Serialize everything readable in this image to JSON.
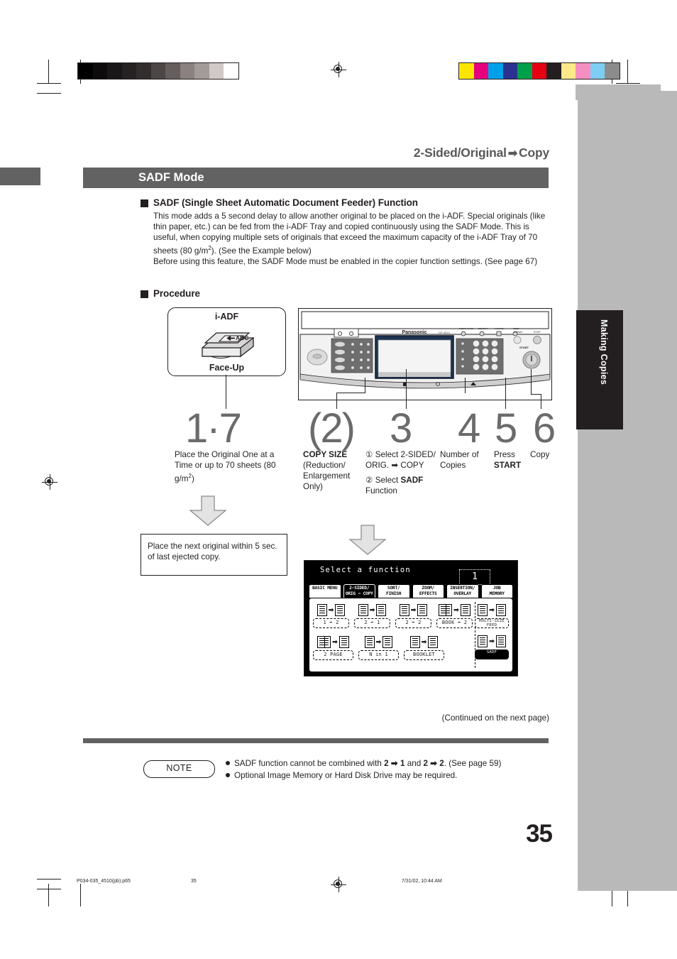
{
  "document": {
    "running_head": "2-Sided/Original",
    "running_head_arrow": "➡",
    "running_head_tail": "Copy",
    "section_title": "SADF Mode",
    "page_number": "35",
    "continued": "(Continued on the next page)",
    "side_tab_label": "Making Copies"
  },
  "function_section": {
    "heading": "SADF (Single Sheet Automatic Document Feeder) Function",
    "paragraph_1": "This mode adds a 5 second delay to allow another original to be placed on the i-ADF. Special originals (like thin paper, etc.) can be fed from the i-ADF Tray and copied continuously using the SADF Mode. This is useful, when copying multiple sets of originals that exceed the maximum capacity of the i-ADF Tray of 70 sheets (80 g/m",
    "paragraph_1_sup": "2",
    "paragraph_1_tail": "). (See the Example below)",
    "paragraph_2": "Before using this feature, the SADF Mode must be enabled in the copier function settings. (See page 67)"
  },
  "procedure": {
    "heading": "Procedure",
    "iadf_label": "i-ADF",
    "faceup_label": "Face-Up",
    "adf_original_text": "ABC",
    "next_original_note": "Place the next original within 5 sec. of last ejected copy.",
    "steps": [
      {
        "number": "1·7",
        "caption": "Place the Original One at a Time or up to 70 sheets (80 g/m",
        "caption_sup": "2",
        "caption_tail": ")"
      },
      {
        "number": "(2)",
        "caption_bold": "COPY SIZE",
        "caption": "(Reduction/ Enlargement Only)"
      },
      {
        "number": "3",
        "sub_1_marker": "①",
        "sub_1_text": "Select 2-SIDED/ ORIG. ➡ COPY",
        "sub_2_marker": "②",
        "sub_2_prefix": "Select ",
        "sub_2_bold": "SADF",
        "sub_2_suffix": " Function"
      },
      {
        "number": "4",
        "caption": "Number of Copies"
      },
      {
        "number": "5",
        "caption_prefix": "Press",
        "caption_bold": "START"
      },
      {
        "number": "6",
        "caption": "Copy"
      }
    ]
  },
  "lcd": {
    "title": "Select a function",
    "copy_count": "1",
    "tabs": [
      {
        "label_1": "BASIC MENU",
        "label_2": "",
        "selected": false
      },
      {
        "label_1": "2-SIDED/",
        "label_2": "ORIG ➡ COPY",
        "selected": true
      },
      {
        "label_1": "SORT/",
        "label_2": "FINISH",
        "selected": false
      },
      {
        "label_1": "ZOOM/",
        "label_2": "EFFECTS",
        "selected": false
      },
      {
        "label_1": "INSERTION/",
        "label_2": "OVERLAY",
        "selected": false
      },
      {
        "label_1": "JOB",
        "label_2": "MEMORY",
        "selected": false
      }
    ],
    "buttons_row_1": [
      {
        "label": "1 ➡ 2"
      },
      {
        "label": "2 ➡ 1"
      },
      {
        "label": "2 ➡ 2"
      },
      {
        "label": "BOOK ➡ 2"
      }
    ],
    "buttons_row_2": [
      {
        "label": "2 PAGE"
      },
      {
        "label": "N in 1"
      },
      {
        "label": "BOOKLET"
      }
    ],
    "buttons_right": [
      {
        "label": "MULTI-SIZE FEED",
        "selected": false
      },
      {
        "label": "SADF",
        "selected": true
      }
    ]
  },
  "panel": {
    "brand": "Panasonic",
    "model": "DP-4510",
    "start_label": "START",
    "clear_label": "CLEAR",
    "stop_label": "STOP"
  },
  "note": {
    "label": "NOTE",
    "item_1_a": "SADF function cannot be combined with ",
    "item_1_b": "2",
    "item_1_c": " ➡ ",
    "item_1_d": "1",
    "item_1_e": " and ",
    "item_1_f": "2",
    "item_1_g": " ➡ ",
    "item_1_h": "2",
    "item_1_i": ". (See page 59)",
    "item_2": "Optional Image Memory or Hard Disk Drive may be required."
  },
  "footer": {
    "filename": "P034-035_4510(pb).p65",
    "page": "35",
    "timestamp": "7/31/02, 10:44 AM"
  },
  "colors": {
    "title_gray": "#626262",
    "side_gray": "#b9b9b9",
    "tab_black": "#231f20",
    "step_gray": "#6b6b6b"
  },
  "calibration": {
    "gray_swatches": [
      "#000000",
      "#0d0b0c",
      "#1a1718",
      "#262223",
      "#332e2e",
      "#4d4646",
      "#665e5d",
      "#8a8180",
      "#a39b99",
      "#d0c9c7",
      "#ffffff"
    ],
    "color_swatches": [
      "#ffe600",
      "#e6007e",
      "#00a0e9",
      "#2b3190",
      "#00a04a",
      "#e60012",
      "#231f20",
      "#fbe98a",
      "#f happy",
      "#7ecef4",
      "#8c8c8c"
    ]
  }
}
